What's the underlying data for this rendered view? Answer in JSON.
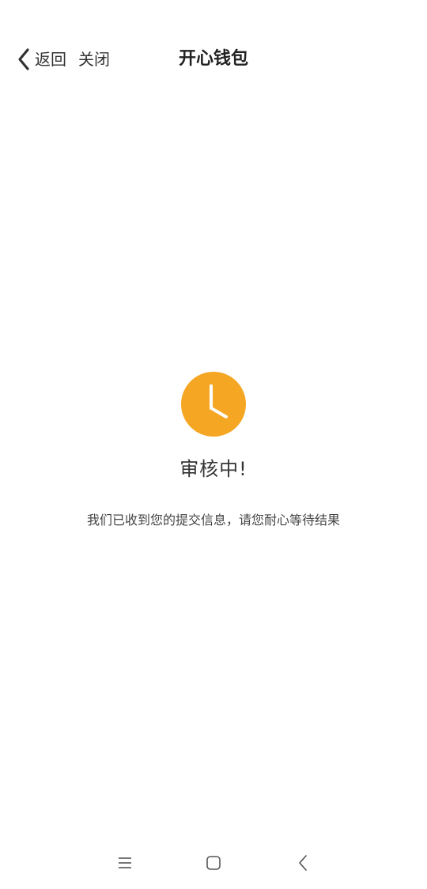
{
  "header": {
    "back_label": "返回",
    "close_label": "关闭",
    "title": "开心钱包"
  },
  "status": {
    "icon": "clock-icon",
    "icon_color": "#F5A623",
    "title": "审核中!",
    "description": "我们已收到您的提交信息，请您耐心等待结果"
  },
  "nav": {
    "menu_icon": "menu-icon",
    "home_icon": "home-icon",
    "back_icon": "back-nav-icon"
  }
}
